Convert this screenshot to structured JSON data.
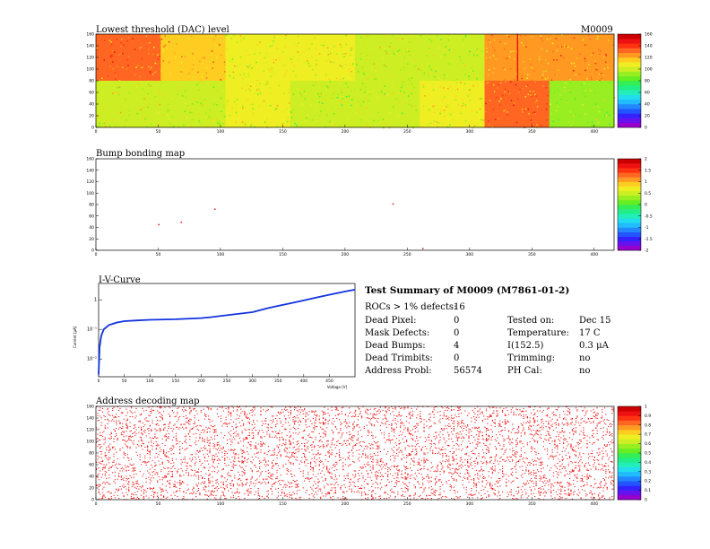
{
  "palette_colors": [
    "#9900cc",
    "#6611ee",
    "#3322ff",
    "#2255ff",
    "#2288ff",
    "#22bbff",
    "#22ddee",
    "#22eebb",
    "#22ee88",
    "#33ee55",
    "#66ee22",
    "#99ee22",
    "#ccee22",
    "#eeee22",
    "#ffcc22",
    "#ff9922",
    "#ff6622",
    "#ff3311",
    "#ee1111",
    "#cc0000"
  ],
  "chart_data": [
    {
      "type": "heatmap",
      "title": "Lowest threshold (DAC) level",
      "module_label": "M0009",
      "x_ticks": [
        "0",
        "50",
        "100",
        "150",
        "200",
        "250",
        "300",
        "350",
        "400"
      ],
      "y_ticks": [
        "0",
        "20",
        "40",
        "60",
        "80",
        "100",
        "120",
        "140",
        "160"
      ],
      "xlim": [
        0,
        416
      ],
      "ylim": [
        0,
        160
      ],
      "palette_ticks": [
        "0",
        "20",
        "40",
        "60",
        "80",
        "100",
        "120",
        "140",
        "160"
      ],
      "palette_range": [
        0,
        160
      ],
      "rocs_top": [
        128,
        118,
        104,
        104,
        102,
        98,
        120,
        125
      ],
      "rocs_bottom": [
        102,
        100,
        104,
        96,
        98,
        104,
        130,
        95
      ],
      "hot_column_x": 338,
      "hot_column_value": 150
    },
    {
      "type": "heatmap",
      "title": "Bump bonding map",
      "x_ticks": [
        "0",
        "50",
        "100",
        "150",
        "200",
        "250",
        "300",
        "350",
        "400"
      ],
      "y_ticks": [
        "0",
        "20",
        "40",
        "60",
        "80",
        "100",
        "120",
        "140",
        "160"
      ],
      "xlim": [
        0,
        416
      ],
      "ylim": [
        0,
        160
      ],
      "palette_ticks": [
        "-2",
        "-1.5",
        "-1",
        "-0.5",
        "0",
        "0.5",
        "1",
        "1.5",
        "2"
      ],
      "palette_range": [
        -2,
        2
      ],
      "points": [
        [
          50,
          46
        ],
        [
          68,
          50
        ],
        [
          95,
          73
        ],
        [
          238,
          82
        ],
        [
          262,
          4
        ]
      ]
    },
    {
      "type": "line",
      "title": "I-V-Curve",
      "xlabel": "Voltage [V]",
      "ylabel": "Current [μA]",
      "x_ticks": [
        "0",
        "50",
        "100",
        "150",
        "200",
        "250",
        "300",
        "350",
        "400",
        "450"
      ],
      "y_ticks": [
        "10⁻²",
        "10⁻¹",
        "1"
      ],
      "xlim": [
        0,
        500
      ],
      "ylog_range": [
        -2.6,
        0.55
      ],
      "series": [
        {
          "x": [
            0,
            2,
            5,
            10,
            20,
            35,
            50,
            75,
            100,
            150,
            200,
            220,
            250,
            300,
            330,
            350,
            380,
            400,
            430,
            460,
            480,
            500
          ],
          "y": [
            0.003,
            0.025,
            0.06,
            0.1,
            0.14,
            0.17,
            0.19,
            0.2,
            0.21,
            0.22,
            0.24,
            0.26,
            0.3,
            0.38,
            0.52,
            0.62,
            0.8,
            0.95,
            1.25,
            1.6,
            1.9,
            2.2
          ]
        }
      ]
    },
    {
      "type": "heatmap",
      "title": "Address decoding map",
      "x_ticks": [
        "0",
        "50",
        "100",
        "150",
        "200",
        "250",
        "300",
        "350",
        "400"
      ],
      "y_ticks": [
        "0",
        "20",
        "40",
        "60",
        "80",
        "100",
        "120",
        "140",
        "160"
      ],
      "xlim": [
        0,
        416
      ],
      "ylim": [
        0,
        160
      ],
      "palette_ticks": [
        "0",
        "0.1",
        "0.2",
        "0.3",
        "0.4",
        "0.5",
        "0.6",
        "0.7",
        "0.8",
        "0.9",
        "1"
      ],
      "palette_range": [
        0,
        1
      ],
      "fill_fraction": 0.07
    }
  ],
  "summary": {
    "title": "Test Summary of M0009 (M7861-01-2)",
    "rocs_label": "ROCs > 1% defects:",
    "rocs_value": "16",
    "left": [
      {
        "label": "Dead Pixel:",
        "value": "0"
      },
      {
        "label": "Mask Defects:",
        "value": "0"
      },
      {
        "label": "Dead Bumps:",
        "value": "4"
      },
      {
        "label": "Dead Trimbits:",
        "value": "0"
      },
      {
        "label": "Address Probl:",
        "value": "56574"
      }
    ],
    "right": [
      {
        "label": "Tested on:",
        "value": "Dec 15"
      },
      {
        "label": "Temperature:",
        "value": "17 C"
      },
      {
        "label": "I(152.5)",
        "value": "0.3 μA"
      },
      {
        "label": "Trimming:",
        "value": "no"
      },
      {
        "label": "PH Cal:",
        "value": "no"
      }
    ]
  }
}
